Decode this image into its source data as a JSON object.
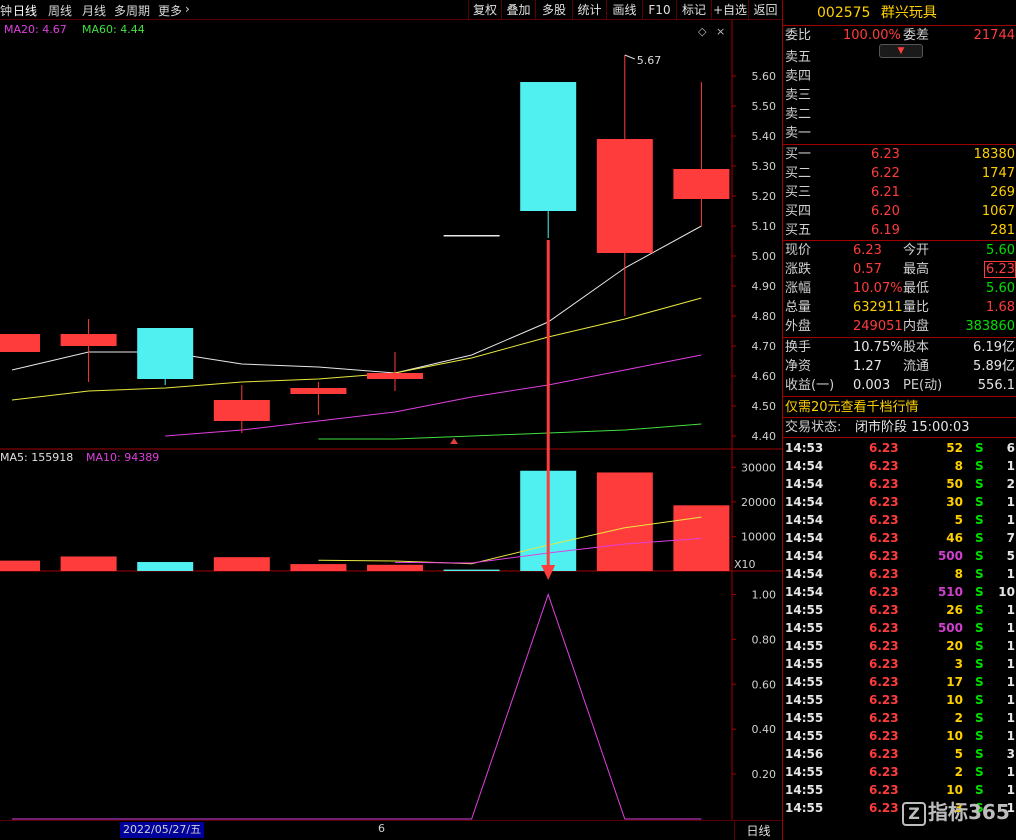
{
  "toolbar": {
    "left_items": [
      "钟",
      "日线",
      "周线",
      "月线",
      "多周期",
      "更多"
    ],
    "right_buttons": [
      "复权",
      "叠加",
      "多股",
      "统计",
      "画线",
      "F10",
      "标记",
      "+自选",
      "返回"
    ]
  },
  "price_panel": {
    "ma_legend": [
      {
        "text": "MA20: 4.67",
        "color": "#e040e0"
      },
      {
        "text": "MA60: 4.44",
        "color": "#40e040"
      }
    ],
    "y_ticks": [
      "5.60",
      "5.50",
      "5.40",
      "5.30",
      "5.20",
      "5.10",
      "5.00",
      "4.90",
      "4.80",
      "4.70",
      "4.60",
      "4.50",
      "4.40"
    ],
    "high_label": "5.67"
  },
  "volume_panel": {
    "ma_legend": [
      {
        "text": "MA5: 155918",
        "color": "#e0e0e0"
      },
      {
        "text": "MA10: 94389",
        "color": "#e040e0"
      }
    ],
    "y_ticks": [
      "30000",
      "20000",
      "10000"
    ],
    "unit_label": "X10"
  },
  "indicator_panel": {
    "y_ticks": [
      "1.00",
      "0.80",
      "0.60",
      "0.40",
      "0.20"
    ]
  },
  "chart_data": {
    "type": "candlestick",
    "candles": [
      {
        "open": 4.74,
        "close": 4.68,
        "high": 4.74,
        "low": 4.68,
        "volume": 3000
      },
      {
        "open": 4.74,
        "close": 4.7,
        "high": 4.79,
        "low": 4.58,
        "volume": 4200
      },
      {
        "open": 4.59,
        "close": 4.76,
        "high": 4.76,
        "low": 4.57,
        "volume": 2600
      },
      {
        "open": 4.52,
        "close": 4.45,
        "high": 4.57,
        "low": 4.41,
        "volume": 4000
      },
      {
        "open": 4.56,
        "close": 4.54,
        "high": 4.58,
        "low": 4.47,
        "volume": 2000
      },
      {
        "open": 4.61,
        "close": 4.59,
        "high": 4.68,
        "low": 4.55,
        "volume": 1800
      },
      {
        "open": 5.07,
        "close": 5.07,
        "high": 5.07,
        "low": 5.07,
        "volume": 400
      },
      {
        "open": 5.15,
        "close": 5.58,
        "high": 5.58,
        "low": 5.06,
        "volume": 29000
      },
      {
        "open": 5.39,
        "close": 5.01,
        "high": 5.67,
        "low": 4.8,
        "volume": 28500
      },
      {
        "open": 5.29,
        "close": 5.19,
        "high": 5.58,
        "low": 5.1,
        "volume": 19000
      }
    ],
    "bullish_color": "#50f0f0",
    "bearish_color": "#ff3c3c",
    "ma_price_short": [
      4.62,
      4.68,
      4.68,
      4.64,
      4.63,
      4.61,
      4.67,
      4.78,
      4.96,
      5.1
    ],
    "ma_price_mid": [
      4.52,
      4.55,
      4.56,
      4.58,
      4.59,
      4.61,
      4.66,
      4.73,
      4.79,
      4.86
    ],
    "ma20": [
      null,
      null,
      4.4,
      4.42,
      4.45,
      4.48,
      4.53,
      4.57,
      4.62,
      4.67
    ],
    "ma60": [
      null,
      null,
      null,
      null,
      4.39,
      4.39,
      4.4,
      4.41,
      4.42,
      4.44
    ],
    "vol_ma5": [
      null,
      null,
      null,
      null,
      3100,
      2900,
      2100,
      7500,
      12500,
      15592
    ],
    "vol_ma10": [
      null,
      null,
      null,
      null,
      null,
      2500,
      2300,
      5200,
      7800,
      9439
    ],
    "indicator": [
      0,
      0,
      0,
      0,
      0,
      0,
      0,
      1.0,
      0,
      0
    ],
    "price_range": [
      4.36,
      5.72
    ],
    "volume_range": [
      0,
      35000
    ],
    "indicator_range": [
      0,
      1.1
    ]
  },
  "quote": {
    "code": "002575",
    "name": "群兴玩具",
    "weibi_label": "委比",
    "weibi_value": "100.00%",
    "weicha_label": "委差",
    "weicha_value": "21744",
    "asks": [
      {
        "label": "卖五"
      },
      {
        "label": "卖四"
      },
      {
        "label": "卖三"
      },
      {
        "label": "卖二"
      },
      {
        "label": "卖一"
      }
    ],
    "bids": [
      {
        "label": "买一",
        "price": "6.23",
        "vol": "18380"
      },
      {
        "label": "买二",
        "price": "6.22",
        "vol": "1747"
      },
      {
        "label": "买三",
        "price": "6.21",
        "vol": "269"
      },
      {
        "label": "买四",
        "price": "6.20",
        "vol": "1067"
      },
      {
        "label": "买五",
        "price": "6.19",
        "vol": "281"
      }
    ],
    "stats": [
      {
        "l1": "现价",
        "v1": "6.23",
        "c1": "red",
        "l2": "今开",
        "v2": "5.60",
        "c2": "green"
      },
      {
        "l1": "涨跌",
        "v1": "0.57",
        "c1": "red",
        "l2": "最高",
        "v2": "6.23",
        "c2": "red"
      },
      {
        "l1": "涨幅",
        "v1": "10.07%",
        "c1": "red",
        "l2": "最低",
        "v2": "5.60",
        "c2": "green"
      },
      {
        "l1": "总量",
        "v1": "632911",
        "c1": "yellow",
        "l2": "量比",
        "v2": "1.68",
        "c2": "red"
      },
      {
        "l1": "外盘",
        "v1": "249051",
        "c1": "red",
        "l2": "内盘",
        "v2": "383860",
        "c2": "green"
      }
    ],
    "stats2": [
      {
        "l1": "换手",
        "v1": "10.75%",
        "l2": "股本",
        "v2": "6.19亿"
      },
      {
        "l1": "净资",
        "v1": "1.27",
        "l2": "流通",
        "v2": "5.89亿"
      },
      {
        "l1": "收益(一)",
        "v1": "0.003",
        "l2": "PE(动)",
        "v2": "556.1"
      }
    ],
    "promo": "仅需20元查看千档行情",
    "status_label": "交易状态:",
    "status_value": "闭市阶段 15:00:03",
    "ticks": [
      {
        "t": "14:53",
        "p": "6.23",
        "v": "52",
        "vc": "yellow",
        "s": "S",
        "n": "6"
      },
      {
        "t": "14:54",
        "p": "6.23",
        "v": "8",
        "vc": "yellow",
        "s": "S",
        "n": "1"
      },
      {
        "t": "14:54",
        "p": "6.23",
        "v": "50",
        "vc": "yellow",
        "s": "S",
        "n": "2"
      },
      {
        "t": "14:54",
        "p": "6.23",
        "v": "30",
        "vc": "yellow",
        "s": "S",
        "n": "1"
      },
      {
        "t": "14:54",
        "p": "6.23",
        "v": "5",
        "vc": "yellow",
        "s": "S",
        "n": "1"
      },
      {
        "t": "14:54",
        "p": "6.23",
        "v": "46",
        "vc": "yellow",
        "s": "S",
        "n": "7"
      },
      {
        "t": "14:54",
        "p": "6.23",
        "v": "500",
        "vc": "purple",
        "s": "S",
        "n": "5"
      },
      {
        "t": "14:54",
        "p": "6.23",
        "v": "8",
        "vc": "yellow",
        "s": "S",
        "n": "1"
      },
      {
        "t": "14:54",
        "p": "6.23",
        "v": "510",
        "vc": "purple",
        "s": "S",
        "n": "10"
      },
      {
        "t": "14:55",
        "p": "6.23",
        "v": "26",
        "vc": "yellow",
        "s": "S",
        "n": "1"
      },
      {
        "t": "14:55",
        "p": "6.23",
        "v": "500",
        "vc": "purple",
        "s": "S",
        "n": "1"
      },
      {
        "t": "14:55",
        "p": "6.23",
        "v": "20",
        "vc": "yellow",
        "s": "S",
        "n": "1"
      },
      {
        "t": "14:55",
        "p": "6.23",
        "v": "3",
        "vc": "yellow",
        "s": "S",
        "n": "1"
      },
      {
        "t": "14:55",
        "p": "6.23",
        "v": "17",
        "vc": "yellow",
        "s": "S",
        "n": "1"
      },
      {
        "t": "14:55",
        "p": "6.23",
        "v": "10",
        "vc": "yellow",
        "s": "S",
        "n": "1"
      },
      {
        "t": "14:55",
        "p": "6.23",
        "v": "2",
        "vc": "yellow",
        "s": "S",
        "n": "1"
      },
      {
        "t": "14:55",
        "p": "6.23",
        "v": "10",
        "vc": "yellow",
        "s": "S",
        "n": "1"
      },
      {
        "t": "14:56",
        "p": "6.23",
        "v": "5",
        "vc": "yellow",
        "s": "S",
        "n": "3"
      },
      {
        "t": "14:55",
        "p": "6.23",
        "v": "2",
        "vc": "yellow",
        "s": "S",
        "n": "1"
      },
      {
        "t": "14:55",
        "p": "6.23",
        "v": "10",
        "vc": "yellow",
        "s": "S",
        "n": "1"
      },
      {
        "t": "14:55",
        "p": "6.23",
        "v": "3",
        "vc": "yellow",
        "s": "S",
        "n": "1"
      }
    ]
  },
  "bottom": {
    "date": "2022/05/27/五",
    "month_marker": "6",
    "period": "日线"
  },
  "watermark": {
    "icon": "Z",
    "text": "指标365"
  }
}
